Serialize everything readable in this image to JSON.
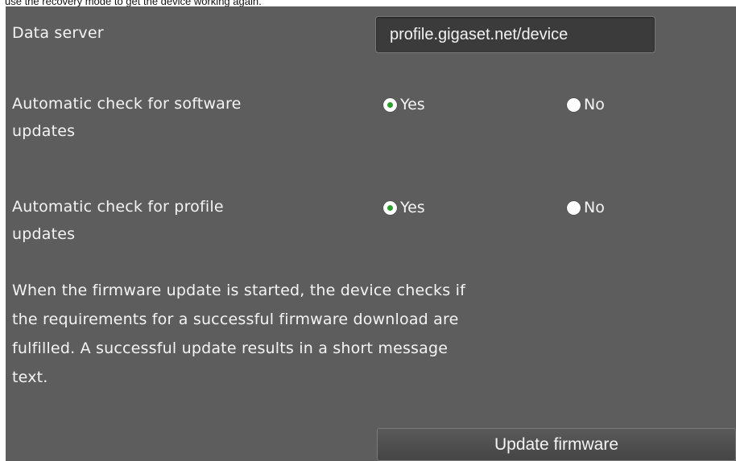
{
  "top_note": "use the recovery mode to get the device working again.",
  "data_server": {
    "label": "Data server",
    "value": "profile.gigaset.net/device"
  },
  "software_updates": {
    "label_line1": "Automatic check for software",
    "label_line2": "updates",
    "option_yes": "Yes",
    "option_no": "No",
    "selected": "Yes"
  },
  "profile_updates": {
    "label_line1": "Automatic check for profile",
    "label_line2": "updates",
    "option_yes": "Yes",
    "option_no": "No",
    "selected": "Yes"
  },
  "description": {
    "line1": "When the firmware update is started, the device checks if",
    "line2": "the requirements for a successful firmware download are",
    "line3": "fulfilled. A successful update results in a short message",
    "line4": "text."
  },
  "update_button": "Update firmware",
  "colors": {
    "panel_background": "#5d5d5d",
    "radio_selected": "#2a9d2a",
    "text": "#f4f4f4"
  }
}
